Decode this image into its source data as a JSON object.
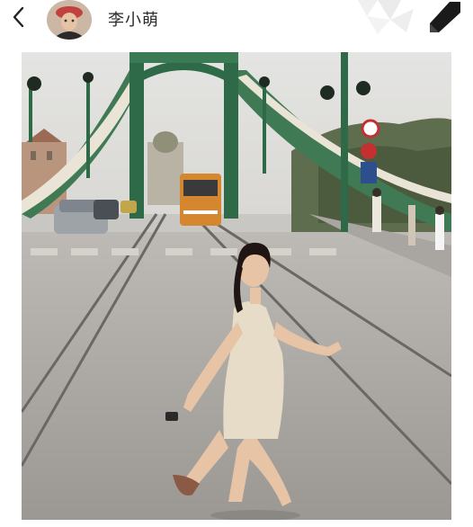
{
  "header": {
    "username": "李小萌",
    "icons": {
      "back": "chevron-left-icon",
      "avatar": "avatar",
      "pen": "pen-icon"
    }
  },
  "post": {
    "image": {
      "subject": "woman-on-bridge-photo"
    }
  }
}
